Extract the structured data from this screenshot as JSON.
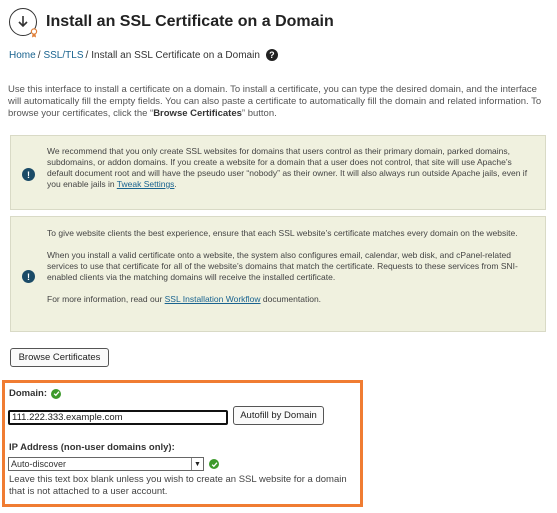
{
  "header": {
    "title": "Install an SSL Certificate on a Domain",
    "icon": "ssl-install-icon"
  },
  "breadcrumb": {
    "items": [
      "Home",
      "SSL/TLS",
      "Install an SSL Certificate on a Domain"
    ],
    "separator": "/",
    "help_icon": "?"
  },
  "intro": {
    "text_before": "Use this interface to install a certificate on a domain. To install a certificate, you can type the desired domain, and the interface will automatically fill the empty fields. You can also paste a certificate to automatically fill the domain and related information. To browse your certificates, click the “",
    "bold": "Browse Certificates",
    "text_after": "” button."
  },
  "notices": [
    {
      "icon": "!",
      "text_before": "We recommend that you only create SSL websites for domains that users control as their primary domain, parked domains, subdomains, or addon domains. If you create a website for a domain that a user does not control, that site will use Apache’s default document root and will have the pseudo user “nobody” as their owner. It will also always run outside Apache jails, even if you enable jails in ",
      "link": "Tweak Settings",
      "text_after": "."
    },
    {
      "icon": "!",
      "p1": "To give website clients the best experience, ensure that each SSL website’s certificate matches every domain on the website.",
      "p2": "When you install a valid certificate onto a website, the system also configures email, calendar, web disk, and cPanel-related services to use that certificate for all of the website’s domains that match the certificate. Requests to these services from SNI-enabled clients via the matching domains will receive the installed certificate.",
      "p3_before": "For more information, read our ",
      "p3_link": "SSL Installation Workflow",
      "p3_after": " documentation."
    }
  ],
  "browse_button": "Browse Certificates",
  "form": {
    "domain_label": "Domain:",
    "domain_value": "111.222.333.example.com",
    "autofill_button": "Autofill by Domain",
    "ip_label": "IP Address (non-user domains only):",
    "ip_selected": "Auto-discover",
    "ip_arrow": "▼",
    "help_text": "Leave this text box blank unless you wish to create an SSL website for a domain that is not attached to a user account."
  },
  "colors": {
    "highlight": "#f07c32",
    "notice_bg": "#f0f1df",
    "link": "#19638f",
    "ok": "#3c9a2b",
    "notice_icon": "#1b4b67"
  }
}
